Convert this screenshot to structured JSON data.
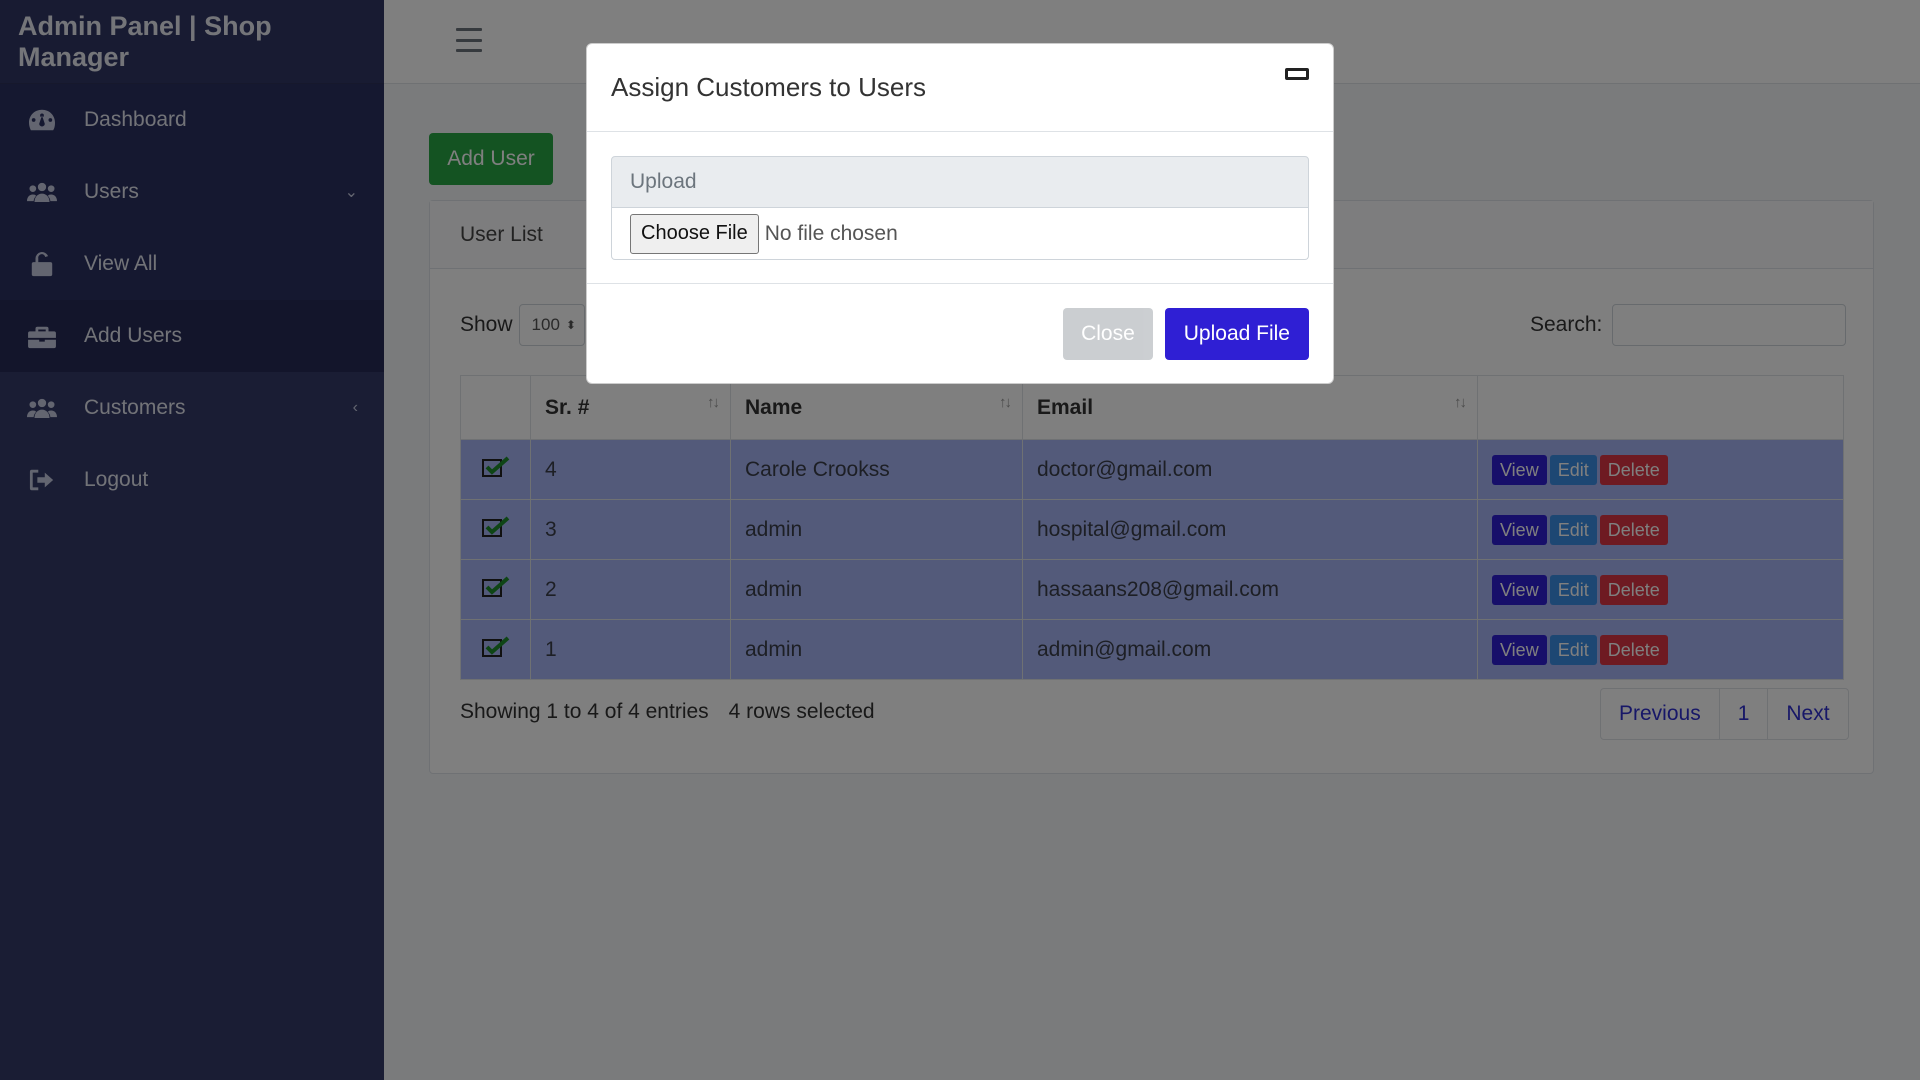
{
  "app": {
    "brand": "Admin Panel | Shop Manager"
  },
  "sidebar": {
    "items": [
      {
        "label": "Dashboard",
        "icon": "dashboard-icon"
      },
      {
        "label": "Users",
        "icon": "users-icon",
        "arrow": "⌄"
      },
      {
        "label": "View All",
        "icon": "unlock-icon"
      },
      {
        "label": "Add Users",
        "icon": "briefcase-icon"
      },
      {
        "label": "Customers",
        "icon": "users-icon",
        "arrow": "‹"
      },
      {
        "label": "Logout",
        "icon": "logout-icon"
      }
    ]
  },
  "content": {
    "add_user_label": "Add User",
    "card_title": "User List",
    "show_label": "Show",
    "show_value": "100",
    "search_label": "Search:",
    "columns": [
      "Sr. #",
      "Name",
      "Email"
    ],
    "rows": [
      {
        "sr": "4",
        "name": "Carole Crookss",
        "email": "doctor@gmail.com"
      },
      {
        "sr": "3",
        "name": "admin",
        "email": "hospital@gmail.com"
      },
      {
        "sr": "2",
        "name": "admin",
        "email": "hassaans208@gmail.com"
      },
      {
        "sr": "1",
        "name": "admin",
        "email": "admin@gmail.com"
      }
    ],
    "row_actions": {
      "view": "View",
      "edit": "Edit",
      "delete": "Delete"
    },
    "info": "Showing 1 to 4 of 4 entries",
    "selected_info": "4 rows selected",
    "pagination": {
      "previous": "Previous",
      "page": "1",
      "next": "Next"
    }
  },
  "modal": {
    "title": "Assign Customers to Users",
    "upload_label": "Upload",
    "choose_file": "Choose File",
    "no_file": "No file chosen",
    "close_label": "Close",
    "upload_button": "Upload File"
  },
  "colors": {
    "sidebar": "#343a68",
    "success": "#28a745",
    "primary": "#2f1fd4",
    "info": "#3a8ee6",
    "danger": "#dc3545",
    "row_selected": "#a7b4f4"
  }
}
